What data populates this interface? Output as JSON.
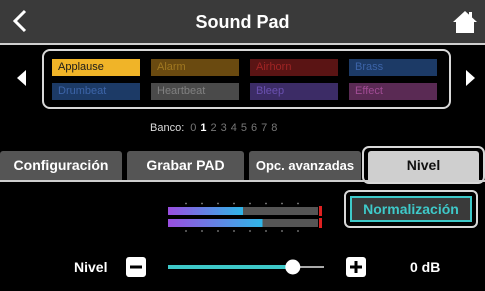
{
  "header": {
    "title": "Sound Pad"
  },
  "pads": [
    {
      "label": "Applause",
      "bg": "#f0b428",
      "fg": "#1a1a1a"
    },
    {
      "label": "Alarm",
      "bg": "#6a4a10",
      "fg": "#a07820"
    },
    {
      "label": "Airhorn",
      "bg": "#5a1414",
      "fg": "#a02424"
    },
    {
      "label": "Brass",
      "bg": "#1c3a66",
      "fg": "#3c64a8"
    },
    {
      "label": "Drumbeat",
      "bg": "#1c3a66",
      "fg": "#3c64a8"
    },
    {
      "label": "Heartbeat",
      "bg": "#4a4a4a",
      "fg": "#808080"
    },
    {
      "label": "Bleep",
      "bg": "#3c2c66",
      "fg": "#6a50b0"
    },
    {
      "label": "Effect",
      "bg": "#5a2a54",
      "fg": "#a04c94"
    }
  ],
  "bank": {
    "label": "Banco:",
    "numbers": [
      "0",
      "1",
      "2",
      "3",
      "4",
      "5",
      "6",
      "7",
      "8"
    ],
    "selected": "1"
  },
  "tabs": [
    {
      "label": "Configuración"
    },
    {
      "label": "Grabar PAD"
    },
    {
      "label": "Opc. avanzadas"
    },
    {
      "label": "Nivel"
    }
  ],
  "normalize": {
    "label": "Normalización"
  },
  "level": {
    "label": "Nivel",
    "value": "0 dB",
    "slider_fraction": 0.8
  },
  "meters": {
    "top_fraction": 0.5,
    "bottom_fraction": 0.63
  },
  "colors": {
    "accent": "#3ec9c9",
    "header_bg": "#3a3a3a",
    "tab_bg": "#555555",
    "tab_active_bg": "#cfcfcf"
  }
}
